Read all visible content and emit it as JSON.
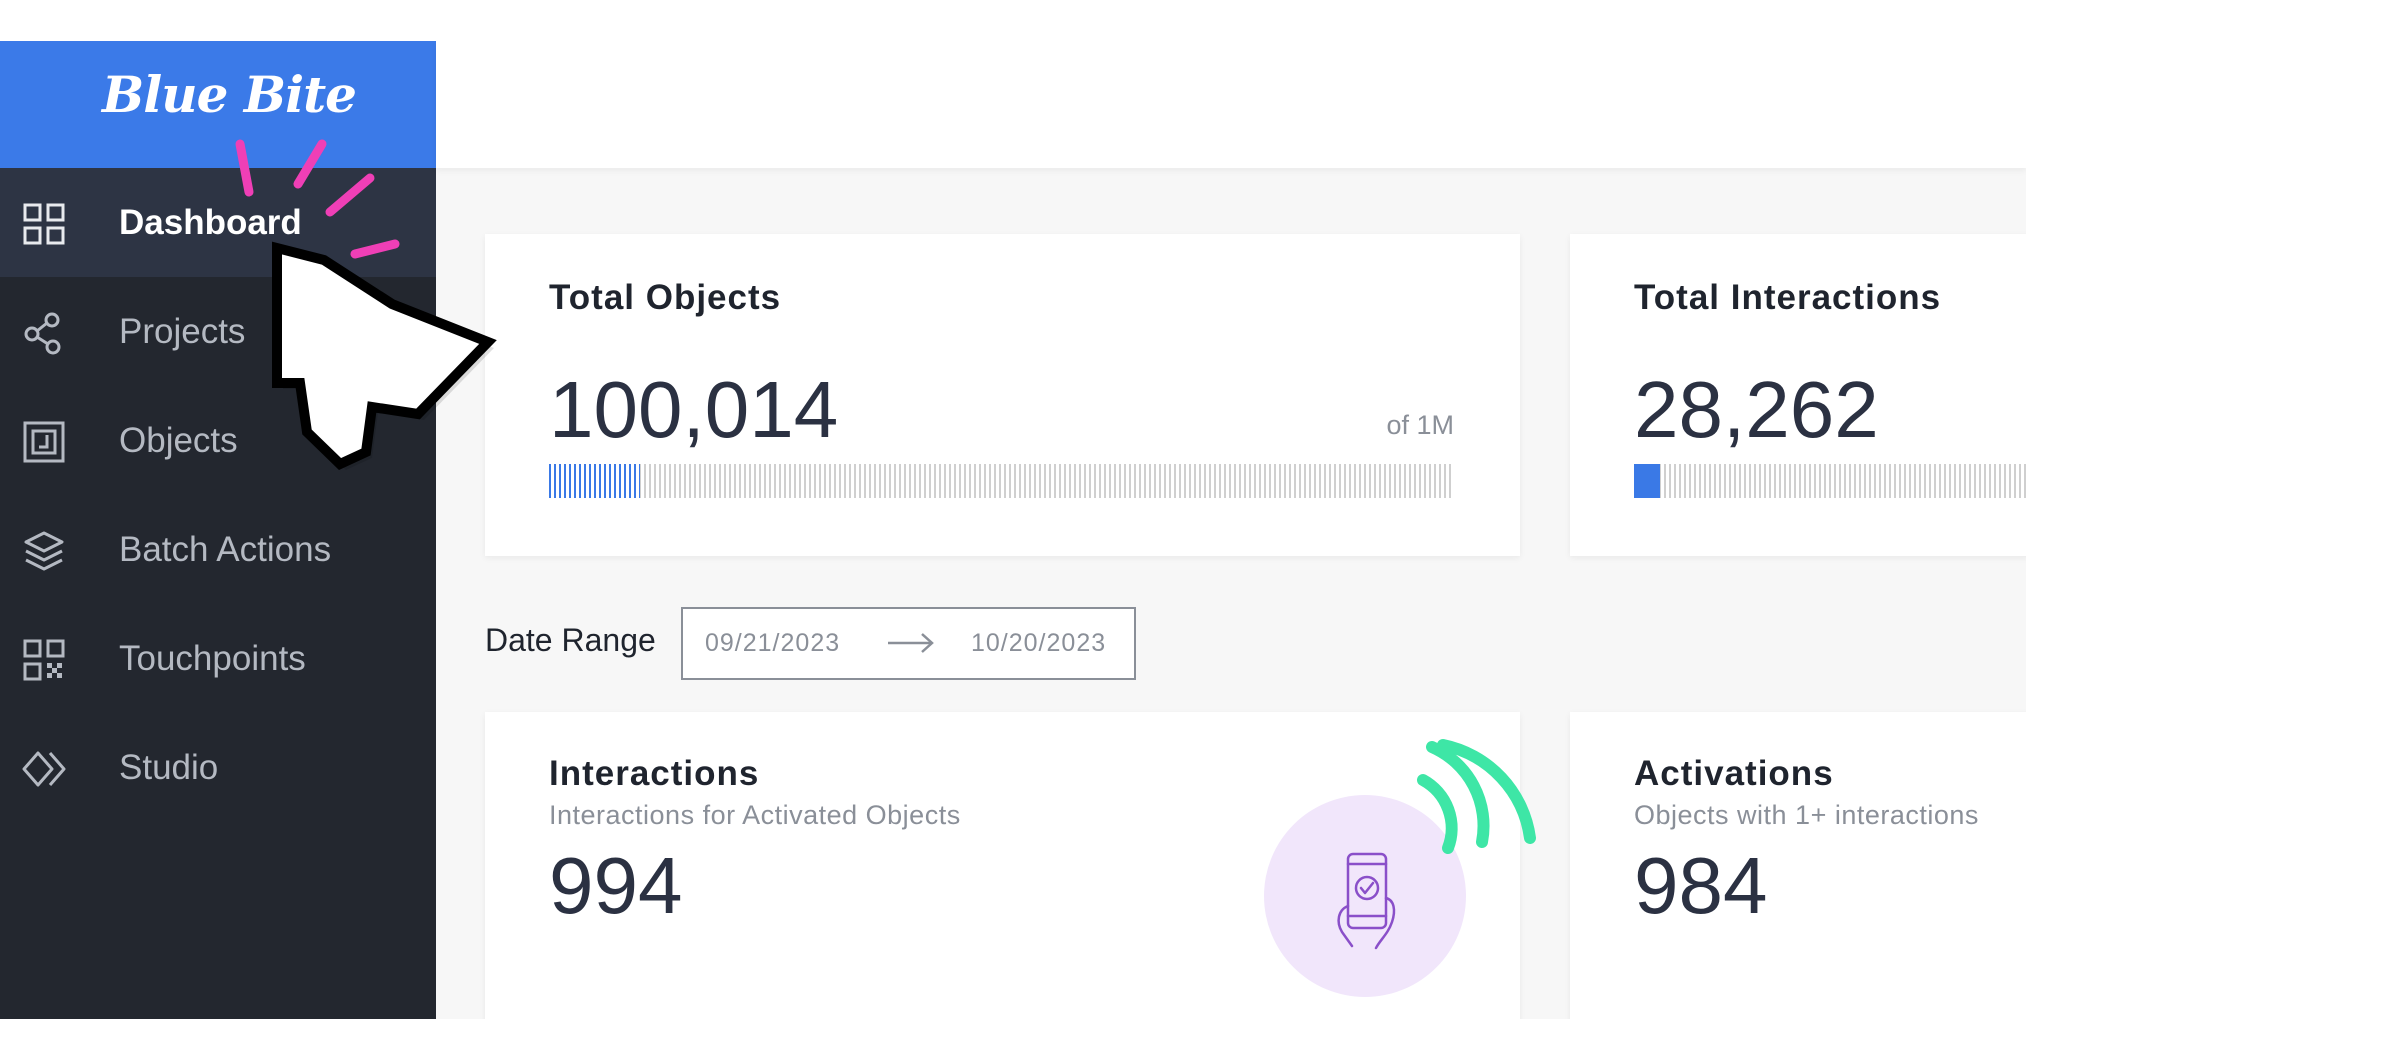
{
  "brand": {
    "name": "Blue Bite",
    "color": "#3b7ae8"
  },
  "sidebar": {
    "items": [
      {
        "label": "Dashboard",
        "icon": "grid-icon",
        "active": true
      },
      {
        "label": "Projects",
        "icon": "share-nodes-icon",
        "active": false
      },
      {
        "label": "Objects",
        "icon": "object-tag-icon",
        "active": false
      },
      {
        "label": "Batch Actions",
        "icon": "layers-icon",
        "active": false
      },
      {
        "label": "Touchpoints",
        "icon": "qr-code-icon",
        "active": false
      },
      {
        "label": "Studio",
        "icon": "diamond-code-icon",
        "active": false
      }
    ]
  },
  "stats": {
    "total_objects": {
      "title": "Total Objects",
      "value": "100,014",
      "limit_label": "of 1M",
      "progress_fraction": 0.100014
    },
    "total_interactions": {
      "title": "Total Interactions",
      "value": "28,262",
      "progress_fraction": 0.028262
    }
  },
  "date_range": {
    "label": "Date Range",
    "start": "09/21/2023",
    "end": "10/20/2023"
  },
  "interactions": {
    "title": "Interactions",
    "subtitle": "Interactions for Activated Objects",
    "value": "994",
    "icon": "phone-check-icon"
  },
  "activations": {
    "title": "Activations",
    "subtitle": "Objects with 1+ interactions",
    "value": "984"
  },
  "decorations": {
    "cursor": "pointer-cursor-icon",
    "click_burst_color": "#ef3fb6",
    "signal_color": "#3ee6a6"
  }
}
